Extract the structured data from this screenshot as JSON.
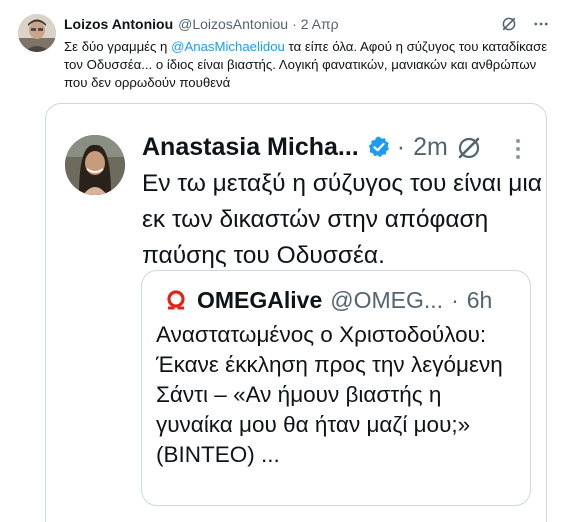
{
  "tweet": {
    "author_name": "Loizos Antoniou",
    "author_handle": "@LoizosAntoniou",
    "separator": "·",
    "time": "2 Απρ",
    "text_before": "Σε δύο γραμμές η ",
    "mention": "@AnasMichaelidou",
    "text_after": " τα είπε όλα. Αφού η σύζυγος του καταδίκασε τον Οδυσσέα... ο ίδιος είναι βιαστής. Λογική φανατικών, μανιακών και ανθρώπων που δεν ορρωδούν πουθενά"
  },
  "quoted_tweet": {
    "author_name": "Anastasia Micha...",
    "separator": "·",
    "time": "2m",
    "text": "Εν τω μεταξύ η σύζυγος του είναι μια εκ των δικαστών στην απόφαση παύσης του Οδυσσέα."
  },
  "nested_quote": {
    "author_name": "OMEGAlive",
    "author_handle": "@OMEG...",
    "separator": "·",
    "time": "6h",
    "text": "Αναστατωμένος ο Χριστοδούλου: Έκανε έκκληση προς την λεγόμενη Σάντι – «Αν ήμουν βιαστής η γυναίκα μου θα ήταν μαζί μου;» (ΒΙΝΤΕΟ) ..."
  },
  "icons": {
    "grok": "grok-slash-circle-icon",
    "more": "more-dots-icon",
    "verified": "verified-badge-icon",
    "logo": "omega-logo-icon"
  },
  "colors": {
    "link": "#1d9bf0",
    "secondary_text": "#536471",
    "border": "#cfd9de",
    "verified": "#1d9bf0",
    "omega_red": "#e2231a"
  }
}
